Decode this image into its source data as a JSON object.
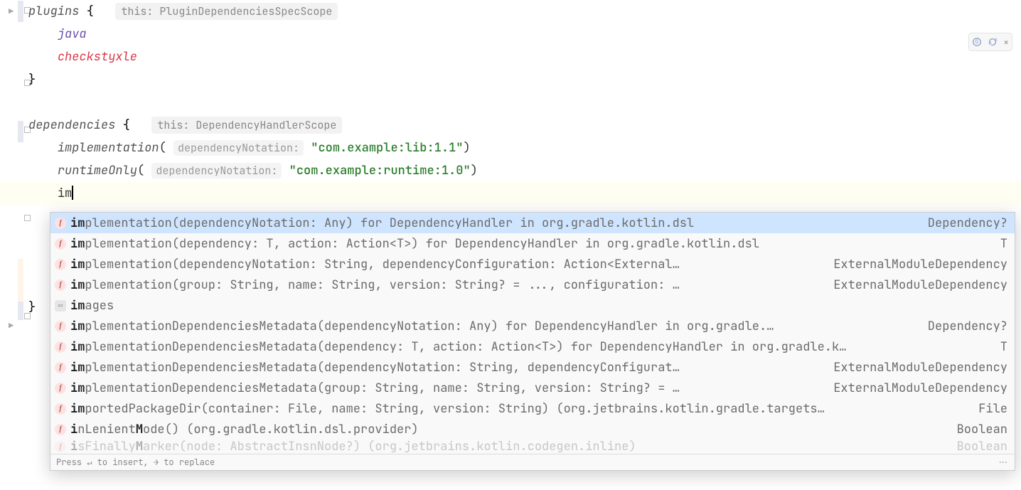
{
  "plugins_block": {
    "keyword": "plugins",
    "scope_hint": "this: PluginDependenciesSpecScope",
    "entries": {
      "java": "java",
      "error_line": "checkstyxle"
    }
  },
  "dependencies_block": {
    "keyword": "dependencies",
    "scope_hint": "this: DependencyHandlerScope",
    "impl_call": "implementation",
    "impl_param_hint": "dependencyNotation:",
    "impl_arg": "\"com.example:lib:1.1\"",
    "runtime_call": "runtimeOnly",
    "runtime_param_hint": "dependencyNotation:",
    "runtime_arg": "\"com.example:runtime:1.0\"",
    "typed_prefix": "im"
  },
  "completion": {
    "typed": "im",
    "items": [
      {
        "kind": "f",
        "prefix": "im",
        "name": "plementation",
        "sig": "(dependencyNotation: Any) for DependencyHandler in org.gradle.kotlin.dsl",
        "type": "Dependency?",
        "selected": true
      },
      {
        "kind": "f",
        "prefix": "im",
        "name": "plementation",
        "sig": "(dependency: T, action: Action<T>) for DependencyHandler in org.gradle.kotlin.dsl",
        "type": "T"
      },
      {
        "kind": "f",
        "prefix": "im",
        "name": "plementation",
        "sig": "(dependencyNotation: String, dependencyConfiguration: Action<External…",
        "type": "ExternalModuleDependency"
      },
      {
        "kind": "f",
        "prefix": "im",
        "name": "plementation",
        "sig": "(group: String, name: String, version: String? = ..., configuration: …",
        "type": "ExternalModuleDependency"
      },
      {
        "kind": "p",
        "prefix": "im",
        "name": "ages",
        "sig": "",
        "type": ""
      },
      {
        "kind": "f",
        "prefix": "im",
        "name": "plementationDependenciesMetadata",
        "sig": "(dependencyNotation: Any) for DependencyHandler in org.gradle.…",
        "type": "Dependency?"
      },
      {
        "kind": "f",
        "prefix": "im",
        "name": "plementationDependenciesMetadata",
        "sig": "(dependency: T, action: Action<T>) for DependencyHandler in org.gradle.k…",
        "type": "T"
      },
      {
        "kind": "f",
        "prefix": "im",
        "name": "plementationDependenciesMetadata",
        "sig": "(dependencyNotation: String, dependencyConfigurat…",
        "type": "ExternalModuleDependency"
      },
      {
        "kind": "f",
        "prefix": "im",
        "name": "plementationDependenciesMetadata",
        "sig": "(group: String, name: String, version: String? = …",
        "type": "ExternalModuleDependency"
      },
      {
        "kind": "f",
        "prefix": "im",
        "name": "portedPackageDir",
        "sig": "(container: File, name: String, version: String) (org.jetbrains.kotlin.gradle.targets…",
        "type": "File"
      },
      {
        "kind": "f",
        "prefix": "i",
        "name": "nLenient",
        "extra": "M",
        "name2": "ode",
        "sig": "() (org.gradle.kotlin.dsl.provider)",
        "type": "Boolean"
      }
    ],
    "cut_item": {
      "kind": "f",
      "prefix": "i",
      "name": "sFinally",
      "extra": "M",
      "name2": "arker",
      "sig": "(node: AbstractInsnNode?) (org.jetbrains.kotlin.codegen.inline)",
      "type": "Boolean"
    },
    "footer_hint": "Press ↵ to insert, → to replace"
  },
  "inspections": {
    "count1": "",
    "count2": ""
  }
}
